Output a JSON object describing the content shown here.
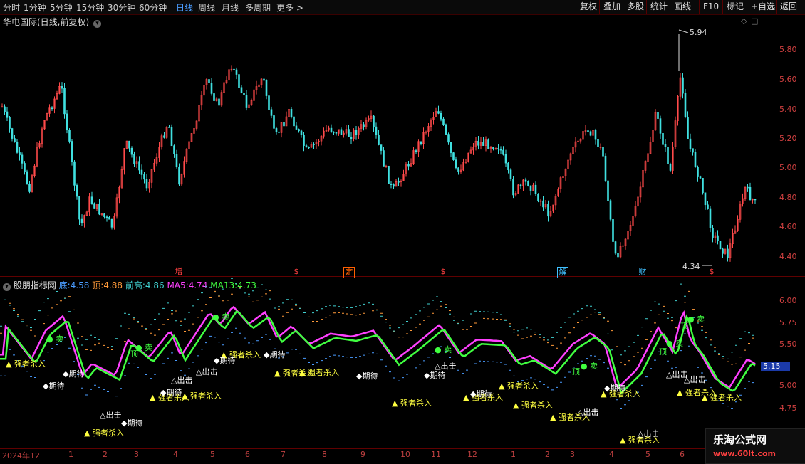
{
  "toolbar": {
    "periods": [
      "分时",
      "1分钟",
      "5分钟",
      "15分钟",
      "30分钟",
      "60分钟",
      "日线",
      "周线",
      "月线",
      "多周期",
      "更多 >"
    ],
    "active_period": "日线",
    "buttons": [
      "复权",
      "叠加",
      "多股",
      "统计",
      "画线",
      "F10",
      "标记",
      "+自选",
      "返回"
    ]
  },
  "main_chart": {
    "title": "华电国际(日线,前复权)",
    "price_axis": [
      "5.80",
      "5.60",
      "5.40",
      "5.20",
      "5.00",
      "4.80",
      "4.60",
      "4.40"
    ],
    "high_label": "5.94",
    "low_label": "4.34",
    "events": [
      {
        "text": "增",
        "color": "#ff4040"
      },
      {
        "text": "$",
        "color": "#ff4040"
      },
      {
        "text": "定",
        "color": "#ff6000"
      },
      {
        "text": "$",
        "color": "#ff4040"
      },
      {
        "text": "解",
        "color": "#40c0ff"
      },
      {
        "text": "财",
        "color": "#40c0ff"
      },
      {
        "text": "$",
        "color": "#ff4040"
      }
    ]
  },
  "indicator": {
    "name": "股朋指标网",
    "legend": [
      {
        "label": "底:",
        "value": "4.58",
        "color": "#4a9cff"
      },
      {
        "label": "顶:",
        "value": "4.88",
        "color": "#ff9a3a"
      },
      {
        "label": "前高:",
        "value": "4.86",
        "color": "#40d0d0"
      },
      {
        "label": "MA5:",
        "value": "4.74",
        "color": "#ff40ff"
      },
      {
        "label": "MA13:",
        "value": "4.73",
        "color": "#40ff40"
      }
    ],
    "axis": [
      "6.00",
      "5.75",
      "5.50",
      "5.25",
      "5.00",
      "4.75"
    ],
    "current_price": "5.15",
    "signals": {
      "sell": "卖",
      "top": "顶",
      "strong_kill": "强者杀入",
      "expect": "期待",
      "strike": "出击"
    }
  },
  "date_axis": [
    "2024年12",
    "1",
    "2",
    "3",
    "4",
    "5",
    "6",
    "7",
    "8",
    "9",
    "10",
    "11",
    "12",
    "1",
    "2",
    "3",
    "4",
    "5",
    "6"
  ],
  "watermark": {
    "title": "乐淘公式网",
    "url": "www.60lt.com"
  }
}
